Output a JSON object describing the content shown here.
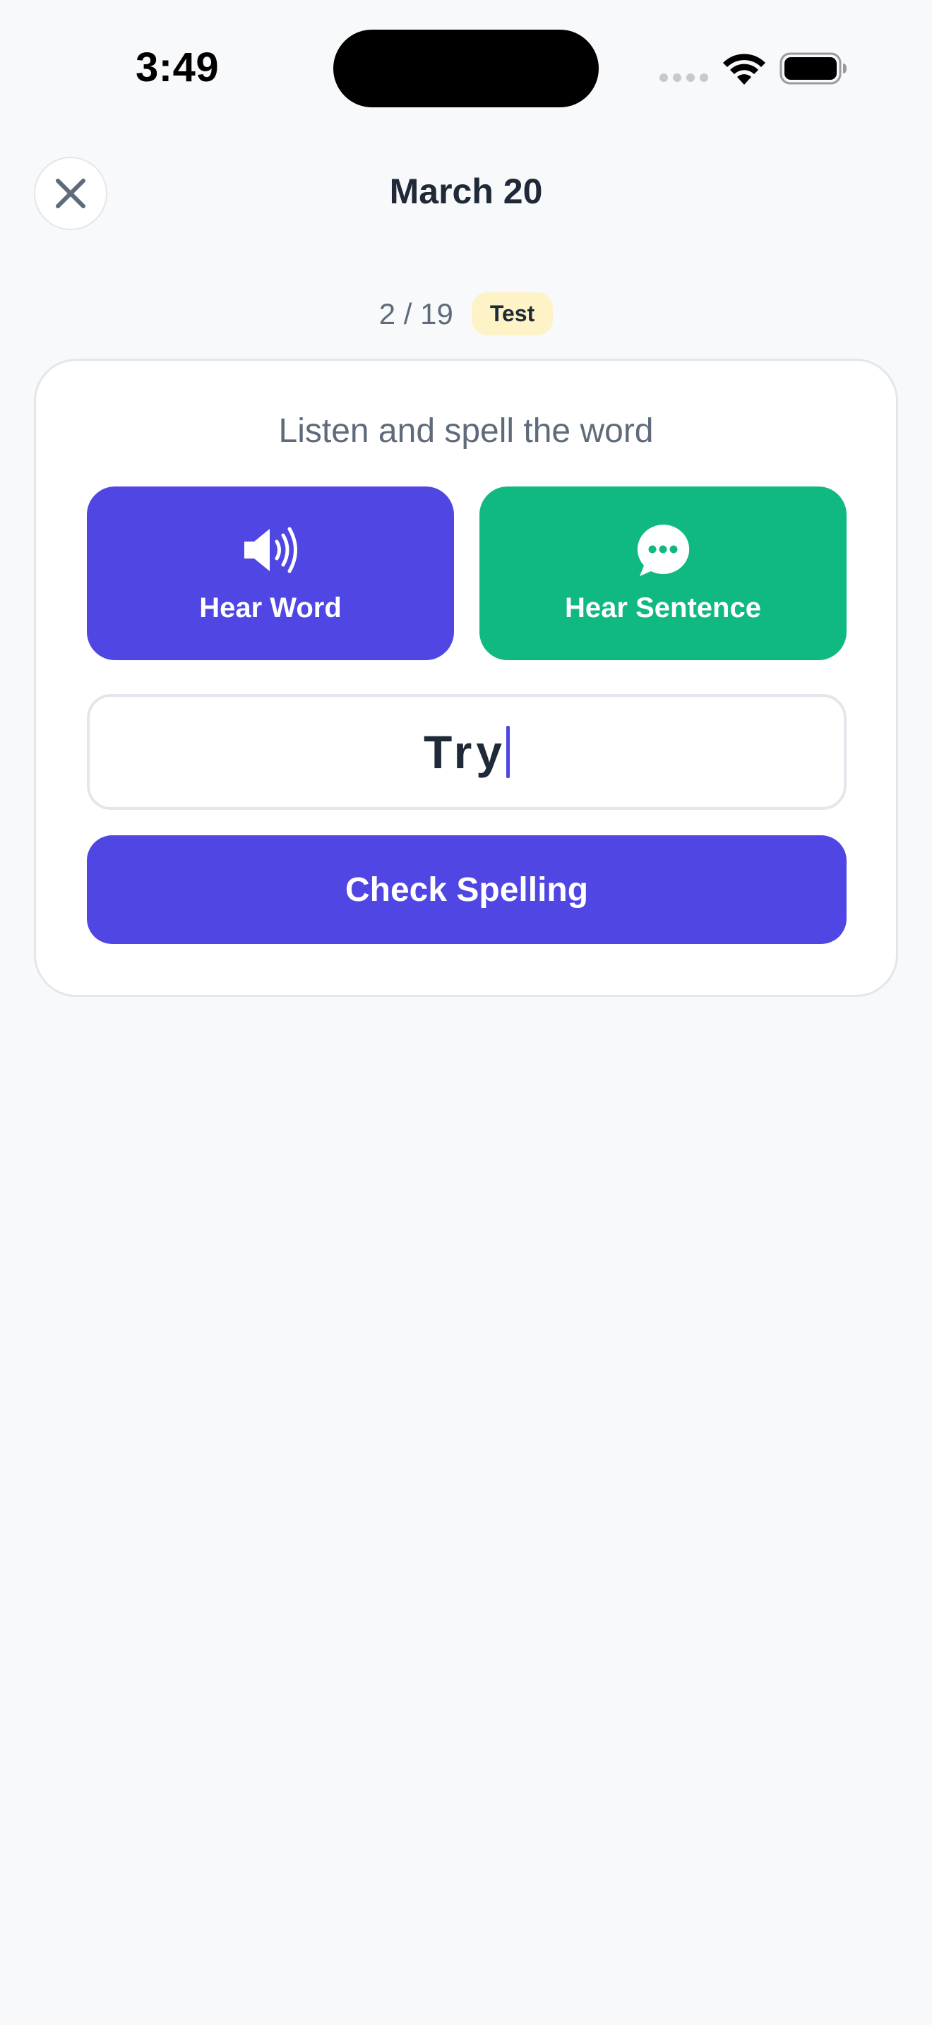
{
  "status_bar": {
    "time": "3:49"
  },
  "header": {
    "title": "March 20",
    "close_icon": "close-icon"
  },
  "progress": {
    "current": 2,
    "total": 19,
    "text": "2 / 19",
    "badge": "Test"
  },
  "card": {
    "instruction": "Listen and spell the word",
    "hear_word": {
      "label": "Hear Word",
      "icon": "speaker-icon"
    },
    "hear_sentence": {
      "label": "Hear Sentence",
      "icon": "speech-bubble-icon"
    },
    "answer": {
      "value": "Try"
    },
    "check_label": "Check Spelling"
  },
  "colors": {
    "primary": "#5046e4",
    "secondary": "#10b981",
    "badge_bg": "#fef3c7",
    "background": "#f8f9fb"
  }
}
